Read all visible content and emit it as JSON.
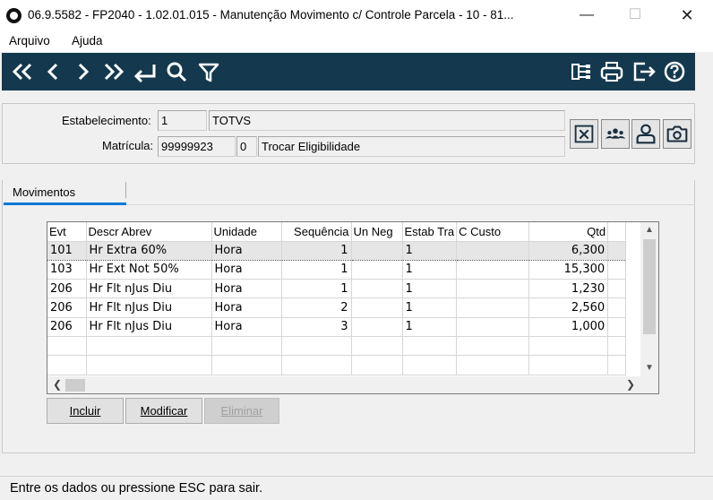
{
  "window": {
    "title": "06.9.5582 - FP2040 - 1.02.01.015 - Manutenção Movimento c/ Controle Parcela - 10 - 81...",
    "minimize_glyph": "—",
    "maximize_glyph": "☐",
    "close_glyph": "✕"
  },
  "menu": [
    "Arquivo",
    "Ajuda"
  ],
  "toolbar": {
    "background": "#14394e",
    "icons": [
      "first-record-icon",
      "previous-record-icon",
      "next-record-icon",
      "last-record-icon",
      "return-icon",
      "search-icon",
      "filter-icon",
      "structure-icon",
      "print-icon",
      "exit-icon",
      "help-icon"
    ]
  },
  "header": {
    "estab_label": "Estabelecimento:",
    "estab_code": "1",
    "estab_name": "TOTVS",
    "matricula_label": "Matrícula:",
    "matricula_value": "99999923",
    "matricula_digit": "0",
    "matricula_desc": "Trocar Eligibilidade"
  },
  "side_buttons": [
    "close-box-icon",
    "group-icon",
    "person-icon",
    "camera-icon"
  ],
  "tabs": [
    {
      "label": "Movimentos",
      "active": true
    }
  ],
  "grid": {
    "columns": [
      "Evt",
      "Descr Abrev",
      "Unidade",
      "Sequência",
      "Un Neg",
      "Estab Tra",
      "C Custo",
      "Qtd"
    ],
    "rows": [
      [
        "101",
        "Hr Extra 60%",
        "Hora",
        "1",
        "",
        "1",
        "",
        "6,300"
      ],
      [
        "103",
        "Hr Ext Not  50%",
        "Hora",
        "1",
        "",
        "1",
        "",
        "15,300"
      ],
      [
        "206",
        "Hr Flt nJus Diu",
        "Hora",
        "1",
        "",
        "1",
        "",
        "1,230"
      ],
      [
        "206",
        "Hr Flt nJus Diu",
        "Hora",
        "2",
        "",
        "1",
        "",
        "2,560"
      ],
      [
        "206",
        "Hr Flt nJus Diu",
        "Hora",
        "3",
        "",
        "1",
        "",
        "1,000"
      ],
      [
        "",
        "",
        "",
        "",
        "",
        "",
        "",
        ""
      ],
      [
        "",
        "",
        "",
        "",
        "",
        "",
        "",
        ""
      ]
    ],
    "selected_row": 0
  },
  "actions": {
    "incluir": "Incluir",
    "modificar": "Modificar",
    "eliminar": "Eliminar"
  },
  "status": "Entre os dados ou pressione ESC para sair."
}
